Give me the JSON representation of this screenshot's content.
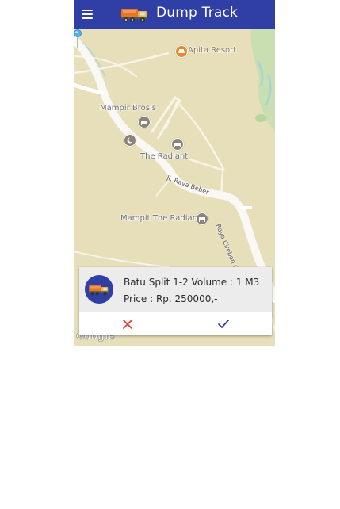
{
  "app": {
    "title": "Dump Track",
    "appbar_color": "#2f3fa6",
    "menu_icon": "hamburger-menu-icon",
    "logo_icon": "dump-truck-icon"
  },
  "map": {
    "pois": [
      {
        "name": "Apita Resort",
        "icon": "restaurant-icon"
      },
      {
        "name": "Mampir Brosis",
        "icon": "hotel-icon"
      },
      {
        "name": "The Radiant",
        "icon": "hotel-icon"
      },
      {
        "name": "Mampit The Radiant",
        "icon": "hotel-icon"
      },
      {
        "name": "",
        "icon": "mosque-icon"
      }
    ],
    "roads": [
      {
        "name": "Jl. Raya Beber"
      },
      {
        "name": "Raya Cirebon Cilimus"
      }
    ],
    "attribution": "Google",
    "pin_icon": "location-pin-icon"
  },
  "order_card": {
    "line1": "Batu Split 1-2 Volume : 1 M3",
    "line2": "Price : Rp. 250000,-",
    "avatar_icon": "dump-truck-icon",
    "reject_icon": "close-icon",
    "accept_icon": "check-icon",
    "reject_color": "#e53935",
    "accept_color": "#2f3fa6"
  }
}
